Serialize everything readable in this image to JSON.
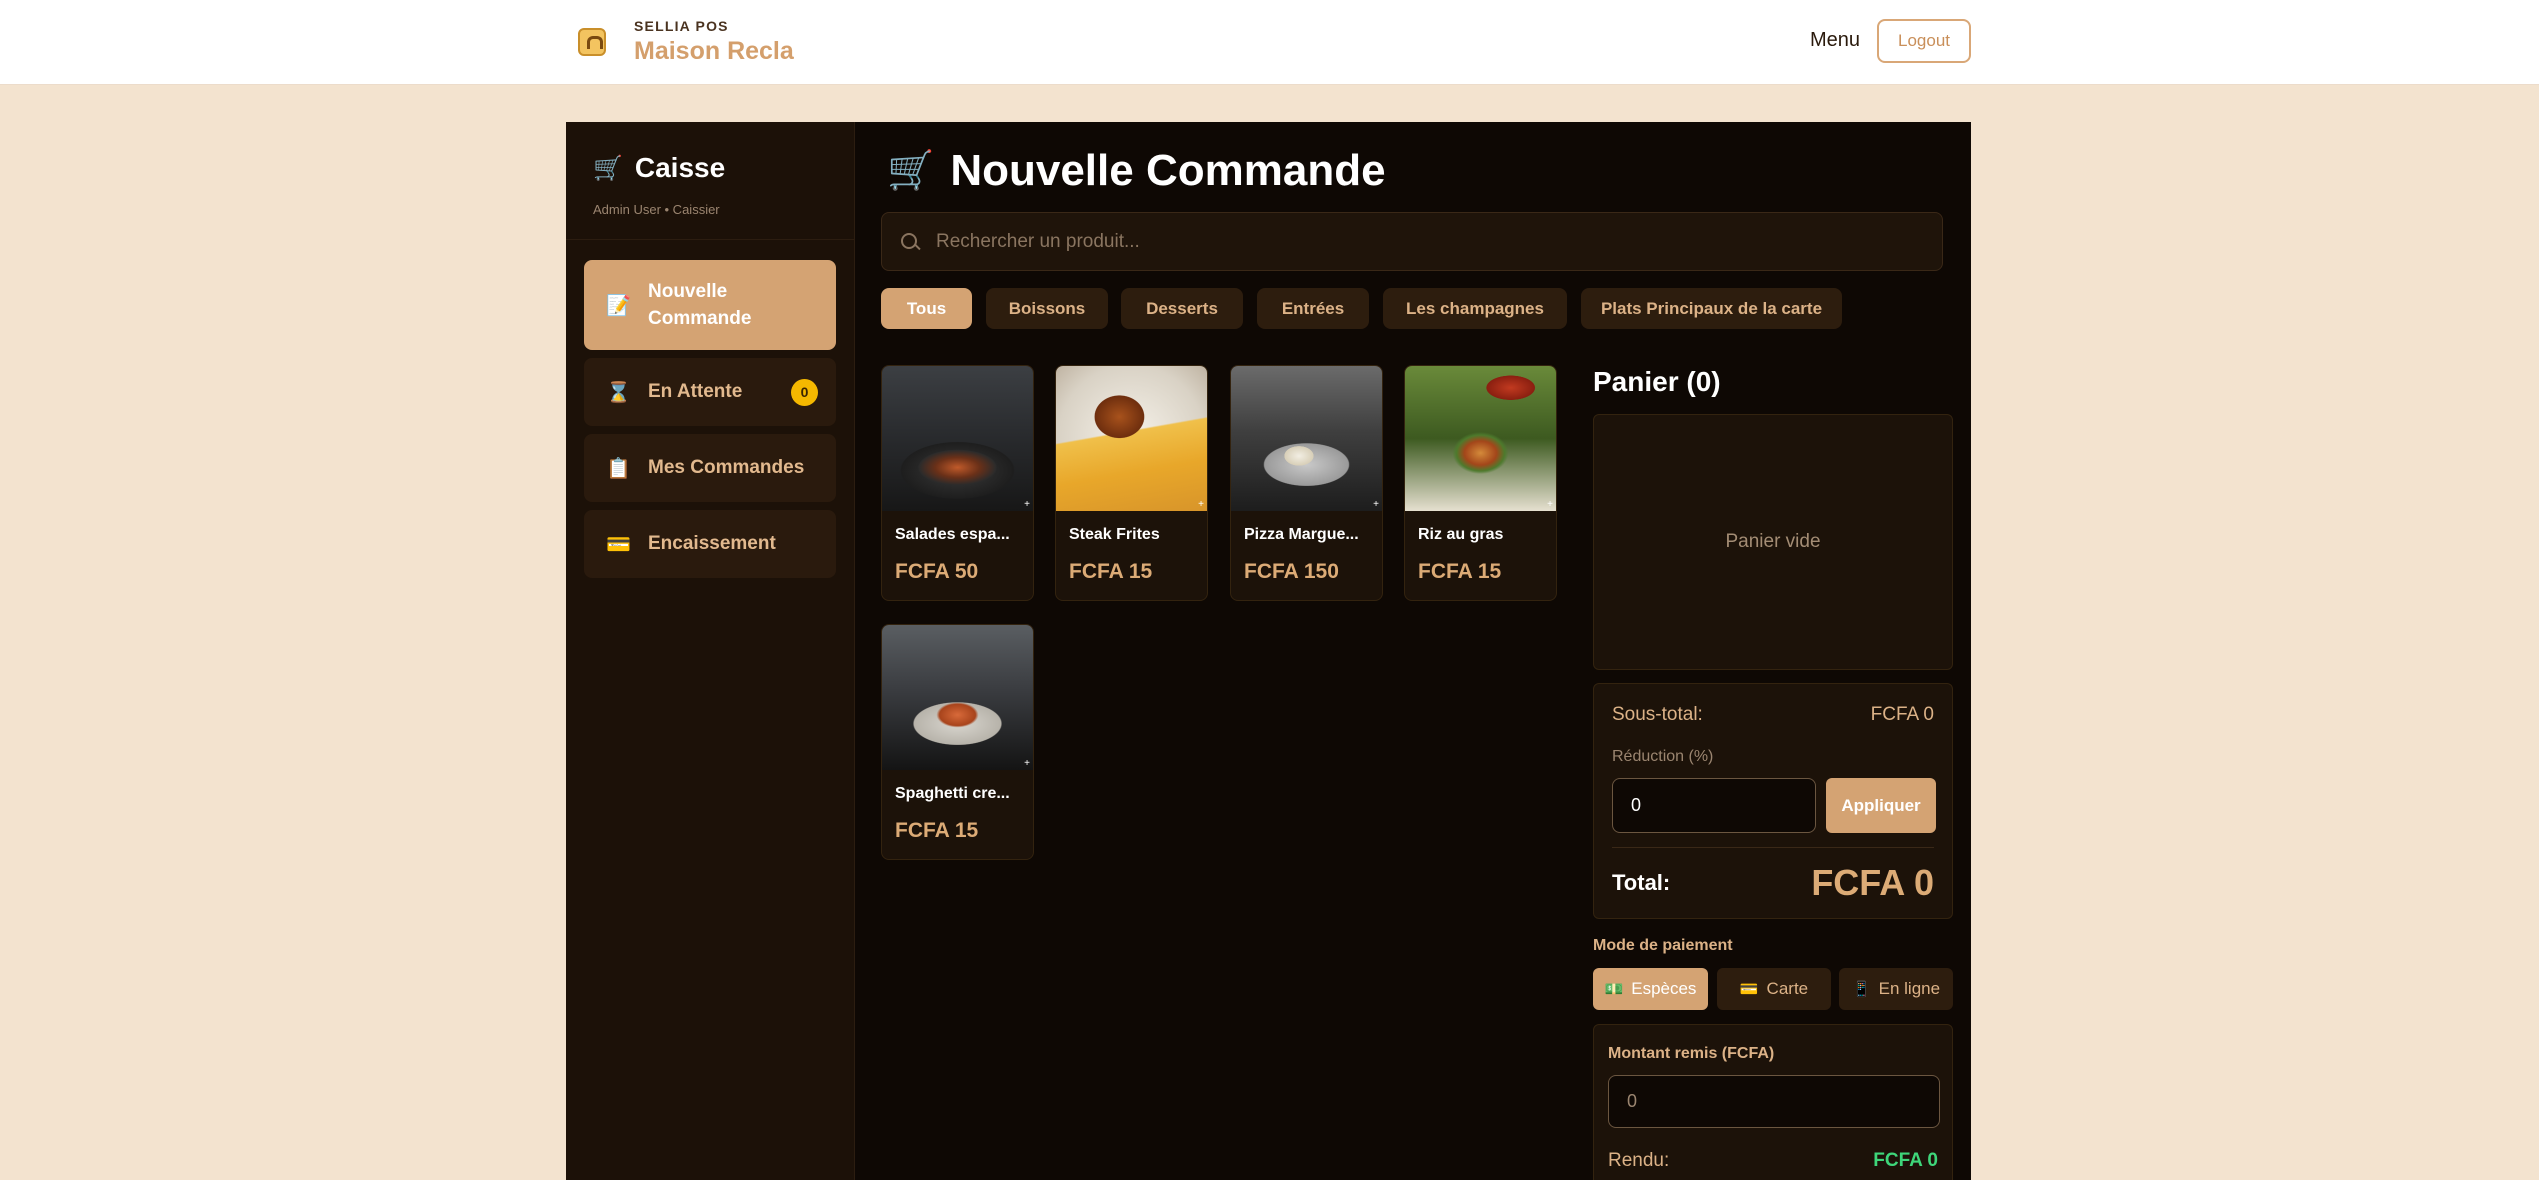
{
  "header": {
    "brand_sub": "SELLIA POS",
    "brand_name": "Maison Recla",
    "menu_label": "Menu",
    "logout_label": "Logout"
  },
  "sidebar": {
    "title": "Caisse",
    "subtitle": "Admin User • Caissier",
    "items": [
      {
        "label": "Nouvelle Commande",
        "icon": "edit-icon",
        "active": true
      },
      {
        "label": "En Attente",
        "icon": "hourglass-icon",
        "badge": "0"
      },
      {
        "label": "Mes Commandes",
        "icon": "clipboard-icon"
      },
      {
        "label": "Encaissement",
        "icon": "credit-card-icon"
      }
    ]
  },
  "main": {
    "title": "Nouvelle Commande",
    "search_placeholder": "Rechercher un produit...",
    "categories": [
      "Tous",
      "Boissons",
      "Desserts",
      "Entrées",
      "Les champagnes",
      "Plats Principaux de la carte"
    ],
    "active_category": "Tous",
    "products": [
      {
        "name": "Salades espagnoles",
        "name_display": "Salades espa...",
        "price": "FCFA 50"
      },
      {
        "name": "Steak Frites",
        "name_display": "Steak Frites",
        "price": "FCFA 15"
      },
      {
        "name": "Pizza Marguerite",
        "name_display": "Pizza Margue...",
        "price": "FCFA 150"
      },
      {
        "name": "Riz au gras",
        "name_display": "Riz au gras",
        "price": "FCFA 15"
      },
      {
        "name": "Spaghetti crevettes",
        "name_display": "Spaghetti cre...",
        "price": "FCFA 15"
      }
    ]
  },
  "cart": {
    "title": "Panier (0)",
    "empty_text": "Panier vide",
    "subtotal_label": "Sous-total:",
    "subtotal_value": "FCFA 0",
    "discount_label": "Réduction (%)",
    "discount_value": "0",
    "apply_label": "Appliquer",
    "total_label": "Total:",
    "total_value": "FCFA 0",
    "payment_title": "Mode de paiement",
    "payment_modes": [
      {
        "label": "Espèces",
        "icon": "cash-icon",
        "active": true
      },
      {
        "label": "Carte",
        "icon": "credit-card-icon"
      },
      {
        "label": "En ligne",
        "icon": "phone-icon"
      }
    ],
    "cash_label": "Montant remis (FCFA)",
    "cash_value": "0",
    "change_label": "Rendu:",
    "change_value": "FCFA 0"
  },
  "colors": {
    "accent": "#d4a373",
    "background": "#0e0804",
    "page_bg": "#f3e3cf",
    "badge": "#f5b800",
    "success": "#3ed67a"
  }
}
